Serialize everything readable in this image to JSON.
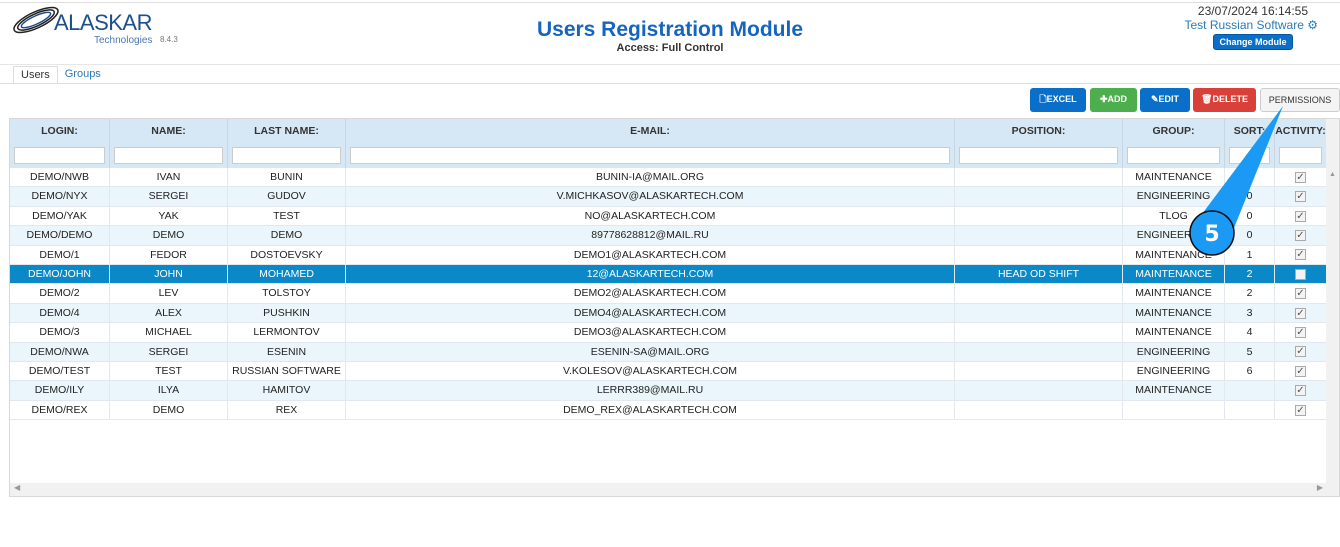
{
  "header": {
    "brand": "ALASKAR",
    "brand_sub": "Technologies",
    "version": "8.4.3",
    "title": "Users Registration Module",
    "access": "Access: Full Control",
    "datetime": "23/07/2024 16:14:55",
    "user": "Test Russian Software",
    "change_module": "Change Module"
  },
  "tabs": [
    {
      "label": "Users",
      "active": true
    },
    {
      "label": "Groups",
      "active": false
    }
  ],
  "toolbar": {
    "excel": "EXCEL",
    "add": "ADD",
    "edit": "EDIT",
    "delete": "DELETE",
    "permissions": "PERMISSIONS"
  },
  "colors": {
    "excel": "#0a6fc9",
    "add": "#4cae4c",
    "edit": "#0a6fc9",
    "delete": "#d9403a",
    "selected_row": "#0a88c8",
    "callout": "#1a9af5"
  },
  "columns": [
    "LOGIN:",
    "NAME:",
    "LAST NAME:",
    "E-MAIL:",
    "POSITION:",
    "GROUP:",
    "SORT:",
    "ACTIVITY:"
  ],
  "rows": [
    [
      "DEMO/NWB",
      "IVAN",
      "BUNIN",
      "BUNIN-IA@MAIL.ORG",
      "",
      "MAINTENANCE",
      "",
      true
    ],
    [
      "DEMO/NYX",
      "SERGEI",
      "GUDOV",
      "V.MICHKASOV@ALASKARTECH.COM",
      "",
      "ENGINEERING",
      "0",
      true
    ],
    [
      "DEMO/YAK",
      "YAK",
      "TEST",
      "NO@ALASKARTECH.COM",
      "",
      "TLOG",
      "0",
      true
    ],
    [
      "DEMO/DEMO",
      "DEMO",
      "DEMO",
      "89778628812@MAIL.RU",
      "",
      "ENGINEERING",
      "0",
      true
    ],
    [
      "DEMO/1",
      "FEDOR",
      "DOSTOEVSKY",
      "DEMO1@ALASKARTECH.COM",
      "",
      "MAINTENANCE",
      "1",
      true
    ],
    [
      "DEMO/JOHN",
      "JOHN",
      "MOHAMED",
      "12@ALASKARTECH.COM",
      "HEAD OD SHIFT",
      "MAINTENANCE",
      "2",
      false
    ],
    [
      "DEMO/2",
      "LEV",
      "TOLSTOY",
      "DEMO2@ALASKARTECH.COM",
      "",
      "MAINTENANCE",
      "2",
      true
    ],
    [
      "DEMO/4",
      "ALEX",
      "PUSHKIN",
      "DEMO4@ALASKARTECH.COM",
      "",
      "MAINTENANCE",
      "3",
      true
    ],
    [
      "DEMO/3",
      "MICHAEL",
      "LERMONTOV",
      "DEMO3@ALASKARTECH.COM",
      "",
      "MAINTENANCE",
      "4",
      true
    ],
    [
      "DEMO/NWA",
      "SERGEI",
      "ESENIN",
      "ESENIN-SA@MAIL.ORG",
      "",
      "ENGINEERING",
      "5",
      true
    ],
    [
      "DEMO/TEST",
      "TEST",
      "RUSSIAN SOFTWARE",
      "V.KOLESOV@ALASKARTECH.COM",
      "",
      "ENGINEERING",
      "6",
      true
    ],
    [
      "DEMO/ILY",
      "ILYA",
      "HAMITOV",
      "LERRR389@MAIL.RU",
      "",
      "MAINTENANCE",
      "",
      true
    ],
    [
      "DEMO/REX",
      "DEMO",
      "REX",
      "DEMO_REX@ALASKARTECH.COM",
      "",
      "",
      "",
      true
    ]
  ],
  "selected_row": 5,
  "callout": {
    "number": "5"
  }
}
